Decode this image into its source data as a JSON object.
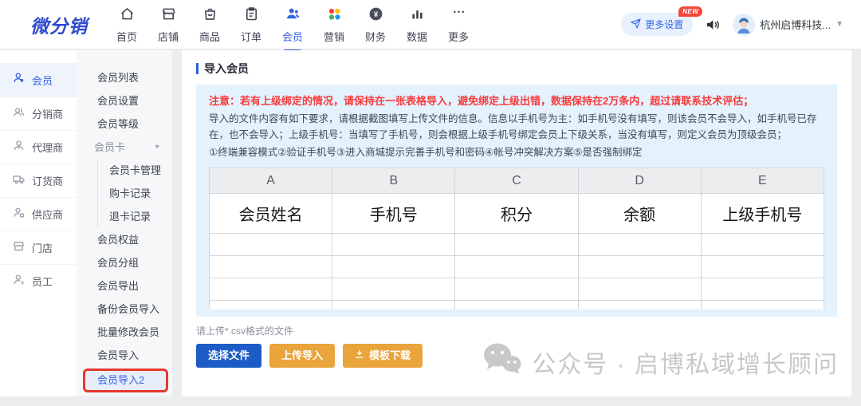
{
  "topbar": {
    "logo": "微分销",
    "nav": [
      {
        "label": "首页"
      },
      {
        "label": "店铺"
      },
      {
        "label": "商品"
      },
      {
        "label": "订单"
      },
      {
        "label": "会员"
      },
      {
        "label": "营销"
      },
      {
        "label": "财务"
      },
      {
        "label": "数据"
      },
      {
        "label": "更多"
      }
    ],
    "settings_label": "更多设置",
    "new_badge": "NEW",
    "account_name": "杭州启博科技..."
  },
  "sidebar": {
    "items": [
      {
        "label": "会员"
      },
      {
        "label": "分销商"
      },
      {
        "label": "代理商"
      },
      {
        "label": "订货商"
      },
      {
        "label": "供应商"
      },
      {
        "label": "门店"
      },
      {
        "label": "员工"
      }
    ]
  },
  "submenu": {
    "member_list": "会员列表",
    "member_settings": "会员设置",
    "member_level": "会员等级",
    "member_card_group": "会员卡",
    "member_card_manage": "会员卡管理",
    "card_purchase_records": "购卡记录",
    "card_refund_records": "退卡记录",
    "member_rights": "会员权益",
    "member_groups": "会员分组",
    "member_export": "会员导出",
    "backup_member_import": "备份会员导入",
    "batch_modify_member": "批量修改会员",
    "member_import": "会员导入",
    "member_import2": "会员导入2"
  },
  "main": {
    "title": "导入会员",
    "notice": {
      "warning": "注意：若有上级绑定的情况，请保持在一张表格导入，避免绑定上级出错，数据保持在2万条内，超过请联系技术评估；",
      "body": "导入的文件内容有如下要求，请根据截图填写上传文件的信息。信息以手机号为主：如手机号没有填写，则该会员不会导入，如手机号已存在，也不会导入；上级手机号：当填写了手机号，则会根据上级手机号绑定会员上下级关系，当没有填写，则定义会员为顶级会员；",
      "steps": "①终端兼容模式②验证手机号③进入商城提示完善手机号和密码④帐号冲突解决方案⑤是否强制绑定"
    },
    "table": {
      "columns": [
        "A",
        "B",
        "C",
        "D",
        "E"
      ],
      "fields": [
        "会员姓名",
        "手机号",
        "积分",
        "余额",
        "上级手机号"
      ]
    },
    "upload_hint": "请上传*.csv格式的文件",
    "buttons": {
      "choose": "选择文件",
      "upload": "上传导入",
      "template": "模板下载"
    }
  },
  "watermark": "公众号 · 启博私域增长顾问",
  "colors": {
    "accent": "#3662E3",
    "warning_red": "#F93A3A",
    "annotation_red": "#E6382C",
    "notice_bg": "#E3F2FD",
    "button_blue": "#1D5BC6",
    "button_orange": "#E9A43C"
  }
}
